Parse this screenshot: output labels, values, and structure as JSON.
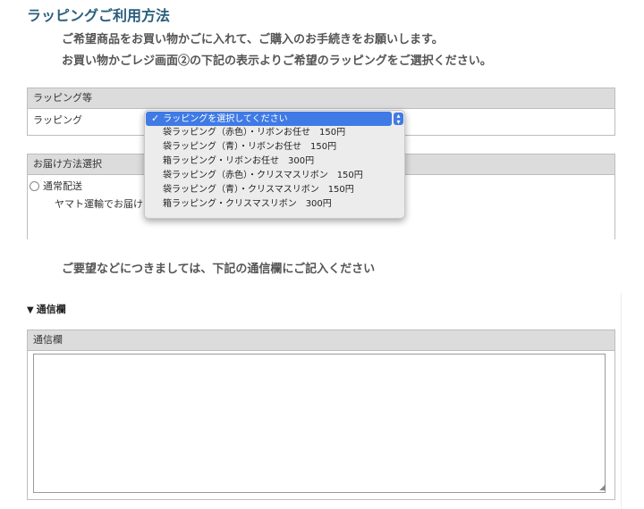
{
  "page_title": "ラッピングご利用方法",
  "intro_lines": [
    "ご希望商品をお買い物かごに入れて、ご購入のお手続きをお願いします。",
    "お買い物かごレジ画面②の下記の表示よりご希望のラッピングをご選択ください。"
  ],
  "wrapping": {
    "header": "ラッピング等",
    "label": "ラッピング",
    "options": [
      "ラッピングを選択してください",
      "袋ラッピング（赤色）・リボンお任せ　150円",
      "袋ラッピング（青）・リボンお任せ　150円",
      "箱ラッピング・リボンお任せ　300円",
      "袋ラッピング（赤色）・クリスマスリボン　150円",
      "袋ラッピング（青）・クリスマスリボン　150円",
      "箱ラッピング・クリスマスリボン　300円"
    ],
    "selected_index": 0,
    "check_icon": "✓",
    "accent_color": "#3f7ae5"
  },
  "shipping": {
    "header": "お届け方法選択",
    "option_label": "通常配送",
    "note": "ヤマト運輸でお届け"
  },
  "request_text": "ご要望などにつきましては、下記の通信欄にご記入ください",
  "communication": {
    "section_label": "通信欄",
    "triangle_icon": "▼",
    "panel_header": "通信欄",
    "textarea_value": ""
  },
  "colors": {
    "title": "#2a5f7d",
    "header_bg": "#dcdcdc"
  }
}
